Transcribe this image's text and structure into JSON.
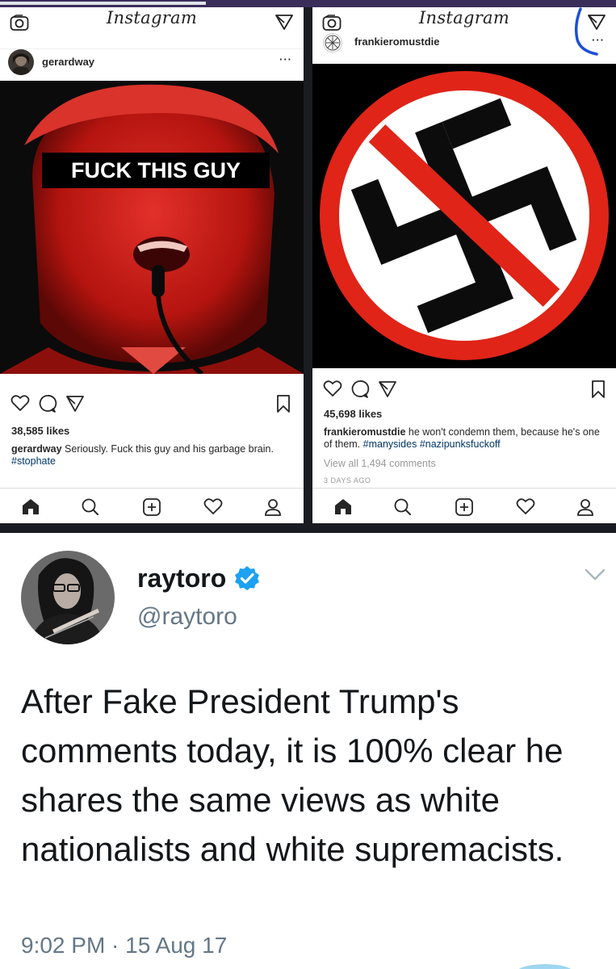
{
  "left_post": {
    "app_title": "Instagram",
    "username": "gerardway",
    "more_label": "···",
    "image_caption_overlay": "FUCK THIS GUY",
    "likes": "38,585 likes",
    "caption_user": "gerardway",
    "caption_text": " Seriously. Fuck this guy and his garbage brain.",
    "hashtag": "#stophate"
  },
  "right_post": {
    "app_title": "Instagram",
    "username": "frankieromustdie",
    "more_label": "···",
    "likes": "45,698 likes",
    "caption_user": "frankieromustdie",
    "caption_text": " he won't condemn them, because he's one of them. ",
    "hashtags": "#manysides #nazipunksfuckoff",
    "view_all": "View all 1,494 comments",
    "time_ago": "3 DAYS AGO"
  },
  "icons": {
    "header": [
      "camera-icon",
      "send-icon"
    ],
    "actions": [
      "heart-icon",
      "comment-icon",
      "share-icon",
      "bookmark-icon"
    ],
    "tabbar": [
      "home-icon",
      "search-icon",
      "add-icon",
      "activity-icon",
      "profile-icon"
    ]
  },
  "tweet": {
    "name": "raytoro",
    "handle": "@raytoro",
    "text": "After Fake President Trump's comments today, it is 100% clear he shares the same views as white nationalists and white supremacists.",
    "timestamp": "9:02 PM · 15 Aug 17"
  },
  "colors": {
    "link_blue": "#003569",
    "verified_blue": "#1da1f2",
    "red_image": "#c81a16",
    "twitter_gray": "#657786"
  }
}
